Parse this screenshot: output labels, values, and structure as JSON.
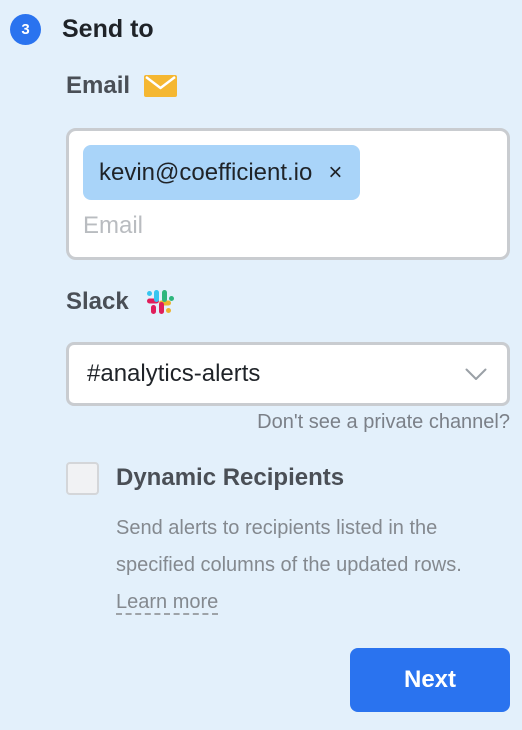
{
  "step": {
    "number": "3",
    "title": "Send to"
  },
  "email": {
    "label": "Email",
    "icon": "envelope-icon",
    "chips": [
      {
        "value": "kevin@coefficient.io",
        "remove_glyph": "×"
      }
    ],
    "input": {
      "value": "",
      "placeholder": "Email"
    }
  },
  "slack": {
    "label": "Slack",
    "icon": "slack-logo-icon",
    "selected_channel": "#analytics-alerts",
    "private_channel_link": "Don't see a private channel?"
  },
  "dynamic_recipients": {
    "checked": false,
    "label": "Dynamic Recipients",
    "description": "Send alerts to recipients listed in the specified columns of the updated rows.",
    "learn_more": "Learn more"
  },
  "next_button": {
    "label": "Next"
  },
  "colors": {
    "background": "#e3f0fb",
    "accent": "#2a73ef",
    "chip": "#a9d4f9",
    "envelope": "#f5b731"
  }
}
